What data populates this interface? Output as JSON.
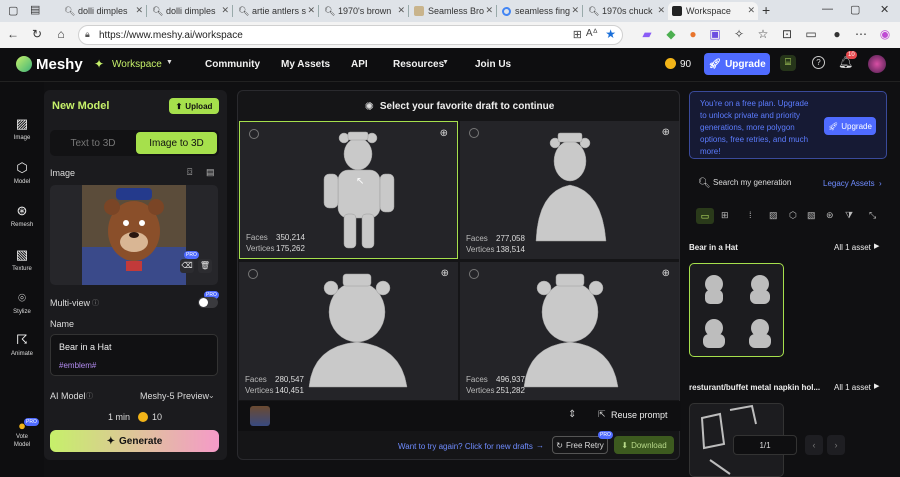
{
  "browser": {
    "tabs": [
      {
        "title": "dolli dimples"
      },
      {
        "title": "dolli dimples"
      },
      {
        "title": "artie antlers s"
      },
      {
        "title": "1970's brown"
      },
      {
        "title": "Seamless Bro"
      },
      {
        "title": "seamless fing"
      },
      {
        "title": "1970s chuck"
      },
      {
        "title": "Workspace"
      }
    ],
    "url": "https://www.meshy.ai/workspace",
    "new_tab": "+"
  },
  "nav": {
    "logo": "Meshy",
    "workspace": "Workspace",
    "community": "Community",
    "assets": "My Assets",
    "api": "API",
    "resources": "Resources",
    "join": "Join Us",
    "credits": "90",
    "upgrade": "Upgrade",
    "notif_count": "10"
  },
  "leftbar": [
    {
      "label": "Image",
      "icon": "image-icon"
    },
    {
      "label": "Model",
      "icon": "cube-icon"
    },
    {
      "label": "Remesh",
      "icon": "remesh-icon"
    },
    {
      "label": "Texture",
      "icon": "texture-icon"
    },
    {
      "label": "Stylize",
      "icon": "stylize-icon"
    },
    {
      "label": "Animate",
      "icon": "animate-icon"
    },
    {
      "label": "Vote\nModel",
      "icon": "vote-icon",
      "badge": "PRO"
    }
  ],
  "panel": {
    "title": "New Model",
    "upload": "Upload",
    "tab_text": "Text to 3D",
    "tab_image": "Image to 3D",
    "image_label": "Image",
    "pro_badge": "PRO",
    "multiview": "Multi-view",
    "name_label": "Name",
    "name_value": "Bear in a Hat",
    "tag": "#emblem#",
    "ai_model_label": "AI Model",
    "ai_model_value": "Meshy-5 Preview",
    "time": "1 min",
    "cost": "10",
    "generate": "Generate"
  },
  "main": {
    "header": "Select your favorite draft to continue",
    "drafts": [
      {
        "faces": "350,214",
        "vertices": "175,262"
      },
      {
        "faces": "277,058",
        "vertices": "138,514"
      },
      {
        "faces": "280,547",
        "vertices": "140,451"
      },
      {
        "faces": "496,937",
        "vertices": "251,282"
      }
    ],
    "faces_label": "Faces",
    "vertices_label": "Vertices",
    "reuse": "Reuse prompt",
    "try_again": "Want to try again? Click for new drafts",
    "free_retry": "Free Retry",
    "download": "Download",
    "pro_badge": "PRO"
  },
  "right": {
    "promo": "You're on a free plan. Upgrade to unlock private and priority generations, more polygon options, free retries, and much more!",
    "promo_upgrade": "Upgrade",
    "search_placeholder": "Search my generation",
    "legacy": "Legacy Assets",
    "group1_title": "Bear in a Hat",
    "group1_count": "All 1 asset",
    "group2_title": "resturant/buffet metal napkin hol...",
    "group2_count": "All 1 asset",
    "pager": "1/1"
  },
  "colors": {
    "accent_green": "#a6e04c",
    "upgrade_blue": "#4f6bff",
    "generate_start": "#c6f06a",
    "generate_end": "#f59ac8"
  }
}
